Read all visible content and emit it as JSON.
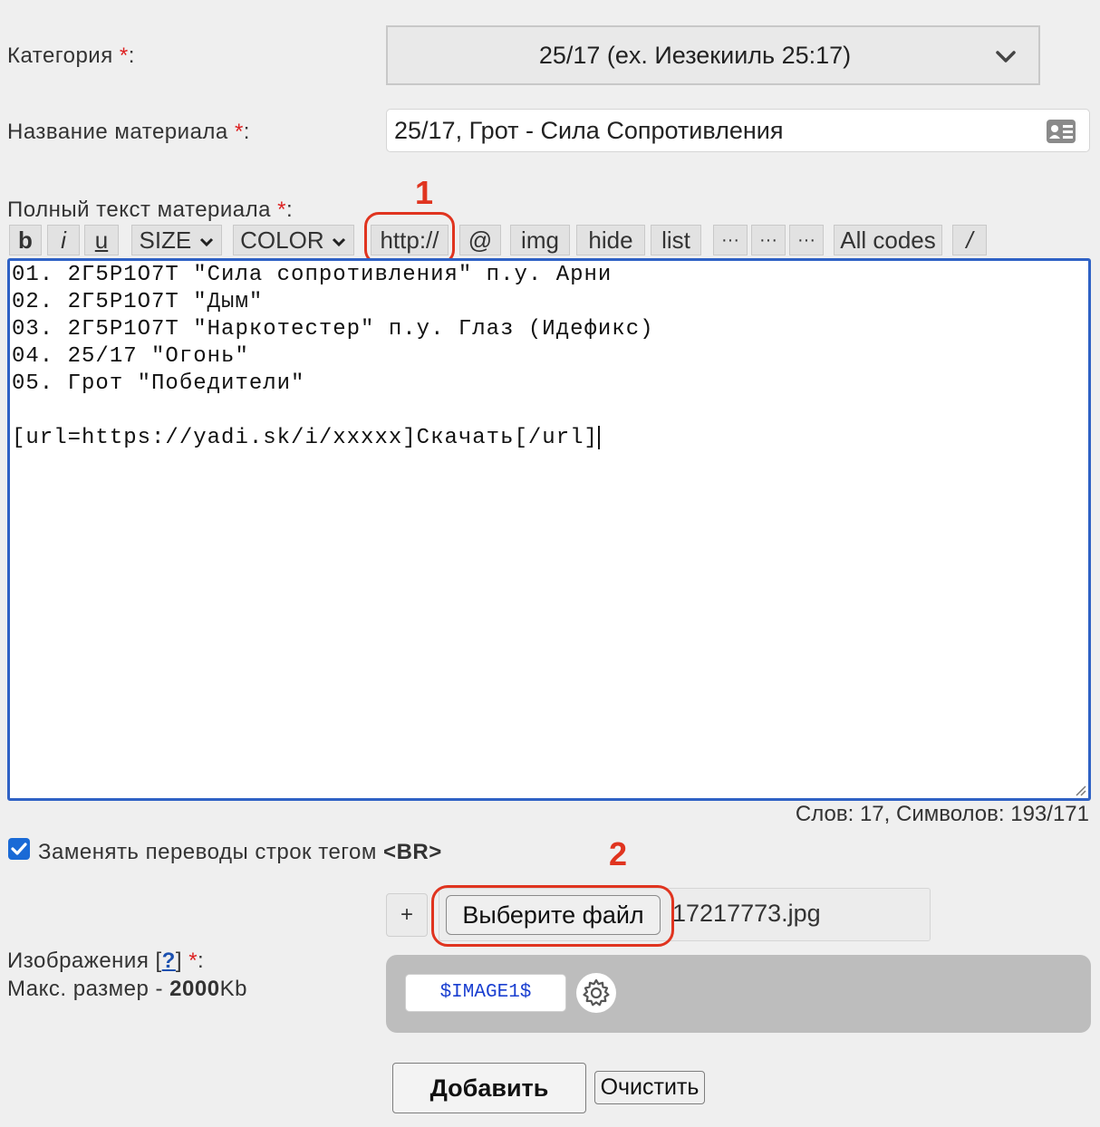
{
  "category": {
    "label": "Категория",
    "required_mark": "*",
    "colon": ":",
    "selected": "25/17 (ex. Иезекииль 25:17)",
    "icon": "chevron-down-icon"
  },
  "title": {
    "label": "Название материала",
    "required_mark": "*",
    "colon": ":",
    "value": "25/17, Грот - Сила Сопротивления",
    "icon": "contact-card-icon"
  },
  "fulltext": {
    "label": "Полный текст материала",
    "required_mark": "*",
    "colon": ":"
  },
  "toolbar": {
    "bold": "b",
    "italic": "i",
    "underline": "u",
    "size": "SIZE",
    "color": "COLOR",
    "url": "http://",
    "email": "@",
    "img": "img",
    "hide": "hide",
    "list": "list",
    "more1": "···",
    "more2": "···",
    "more3": "···",
    "all_codes": "All codes",
    "slash": "/"
  },
  "editor": {
    "lines": [
      "01. 2Г5Р1О7Т \"Сила сопротивления\" п.у. Арни",
      "02. 2Г5Р1О7Т \"Дым\"",
      "03. 2Г5Р1О7Т \"Наркотестер\" п.у. Глаз (Идефикс)",
      "04. 25/17 \"Огонь\"",
      "05. Грот \"Победители\"",
      "",
      "[url=https://yadi.sk/i/xxxxx]Скачать[/url]"
    ]
  },
  "counter": "Слов: 17, Символов: 193/171",
  "br_option": {
    "checked": true,
    "label": "Заменять переводы строк тегом ",
    "tag": "<BR>"
  },
  "annotations": {
    "one": "1",
    "two": "2",
    "color": "#e0341f"
  },
  "file": {
    "plus": "+",
    "button": "Выберите файл",
    "filename": "17217773.jpg"
  },
  "images": {
    "label": "Изображения ",
    "help_open": "[",
    "help": "?",
    "help_close": "]",
    "required_mark": "*",
    "colon": ":",
    "size_prefix": "Макс. размер - ",
    "size_value": "2000",
    "size_unit": "Kb",
    "tag": "$IMAGE1$",
    "settings_icon": "gear-icon"
  },
  "actions": {
    "add": "Добавить",
    "clear": "Очистить"
  },
  "colors": {
    "editor_border": "#2f62c5",
    "required": "#d22222",
    "checkbox": "#1a6ad6",
    "image_tag": "#1a3fd0"
  }
}
